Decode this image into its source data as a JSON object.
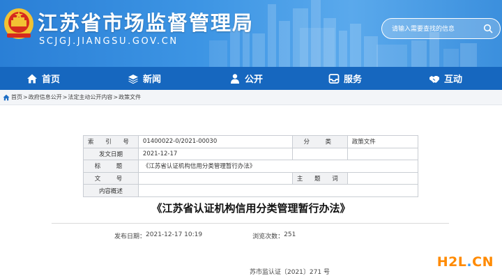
{
  "header": {
    "title": "江苏省市场监督管理局",
    "domain": "SCJGJ.JIANGSU.GOV.CN",
    "search_placeholder": "请输入需要查找的信息",
    "colors": {
      "banner": "#3d95e4",
      "nav": "#1667bf"
    }
  },
  "nav": {
    "items": [
      {
        "label": "首页",
        "icon": "home-icon"
      },
      {
        "label": "新闻",
        "icon": "layers-icon"
      },
      {
        "label": "公开",
        "icon": "person-icon"
      },
      {
        "label": "服务",
        "icon": "tray-icon"
      },
      {
        "label": "互动",
        "icon": "handshake-icon"
      }
    ]
  },
  "breadcrumb": {
    "items": [
      "首页",
      "政府信息公开",
      "法定主动公开内容",
      "政策文件"
    ],
    "separator": ">"
  },
  "info": {
    "index_label": "索 引 号",
    "index_value": "01400022-0/2021-00030",
    "category_label": "分　类",
    "category_value": "政策文件",
    "date_label": "发文日期",
    "date_value": "2021-12-17",
    "title_label": "标　题",
    "title_value": "《江苏省认证机构信用分类管理暂行办法》",
    "docno_label": "文　号",
    "docno_value": "",
    "keywords_label": "主 题 词",
    "keywords_value": "",
    "summary_label": "内容概述",
    "summary_value": ""
  },
  "article": {
    "title": "《江苏省认证机构信用分类管理暂行办法》",
    "publish_label": "发布日期：",
    "publish_value": "2021-12-17 10:19",
    "views_label": "浏览次数：",
    "views_value": "251",
    "doc_number": "苏市监认证〔2021〕271 号"
  },
  "watermark": {
    "text_left": "H2L",
    "dot": ".",
    "text_right": "CN"
  }
}
